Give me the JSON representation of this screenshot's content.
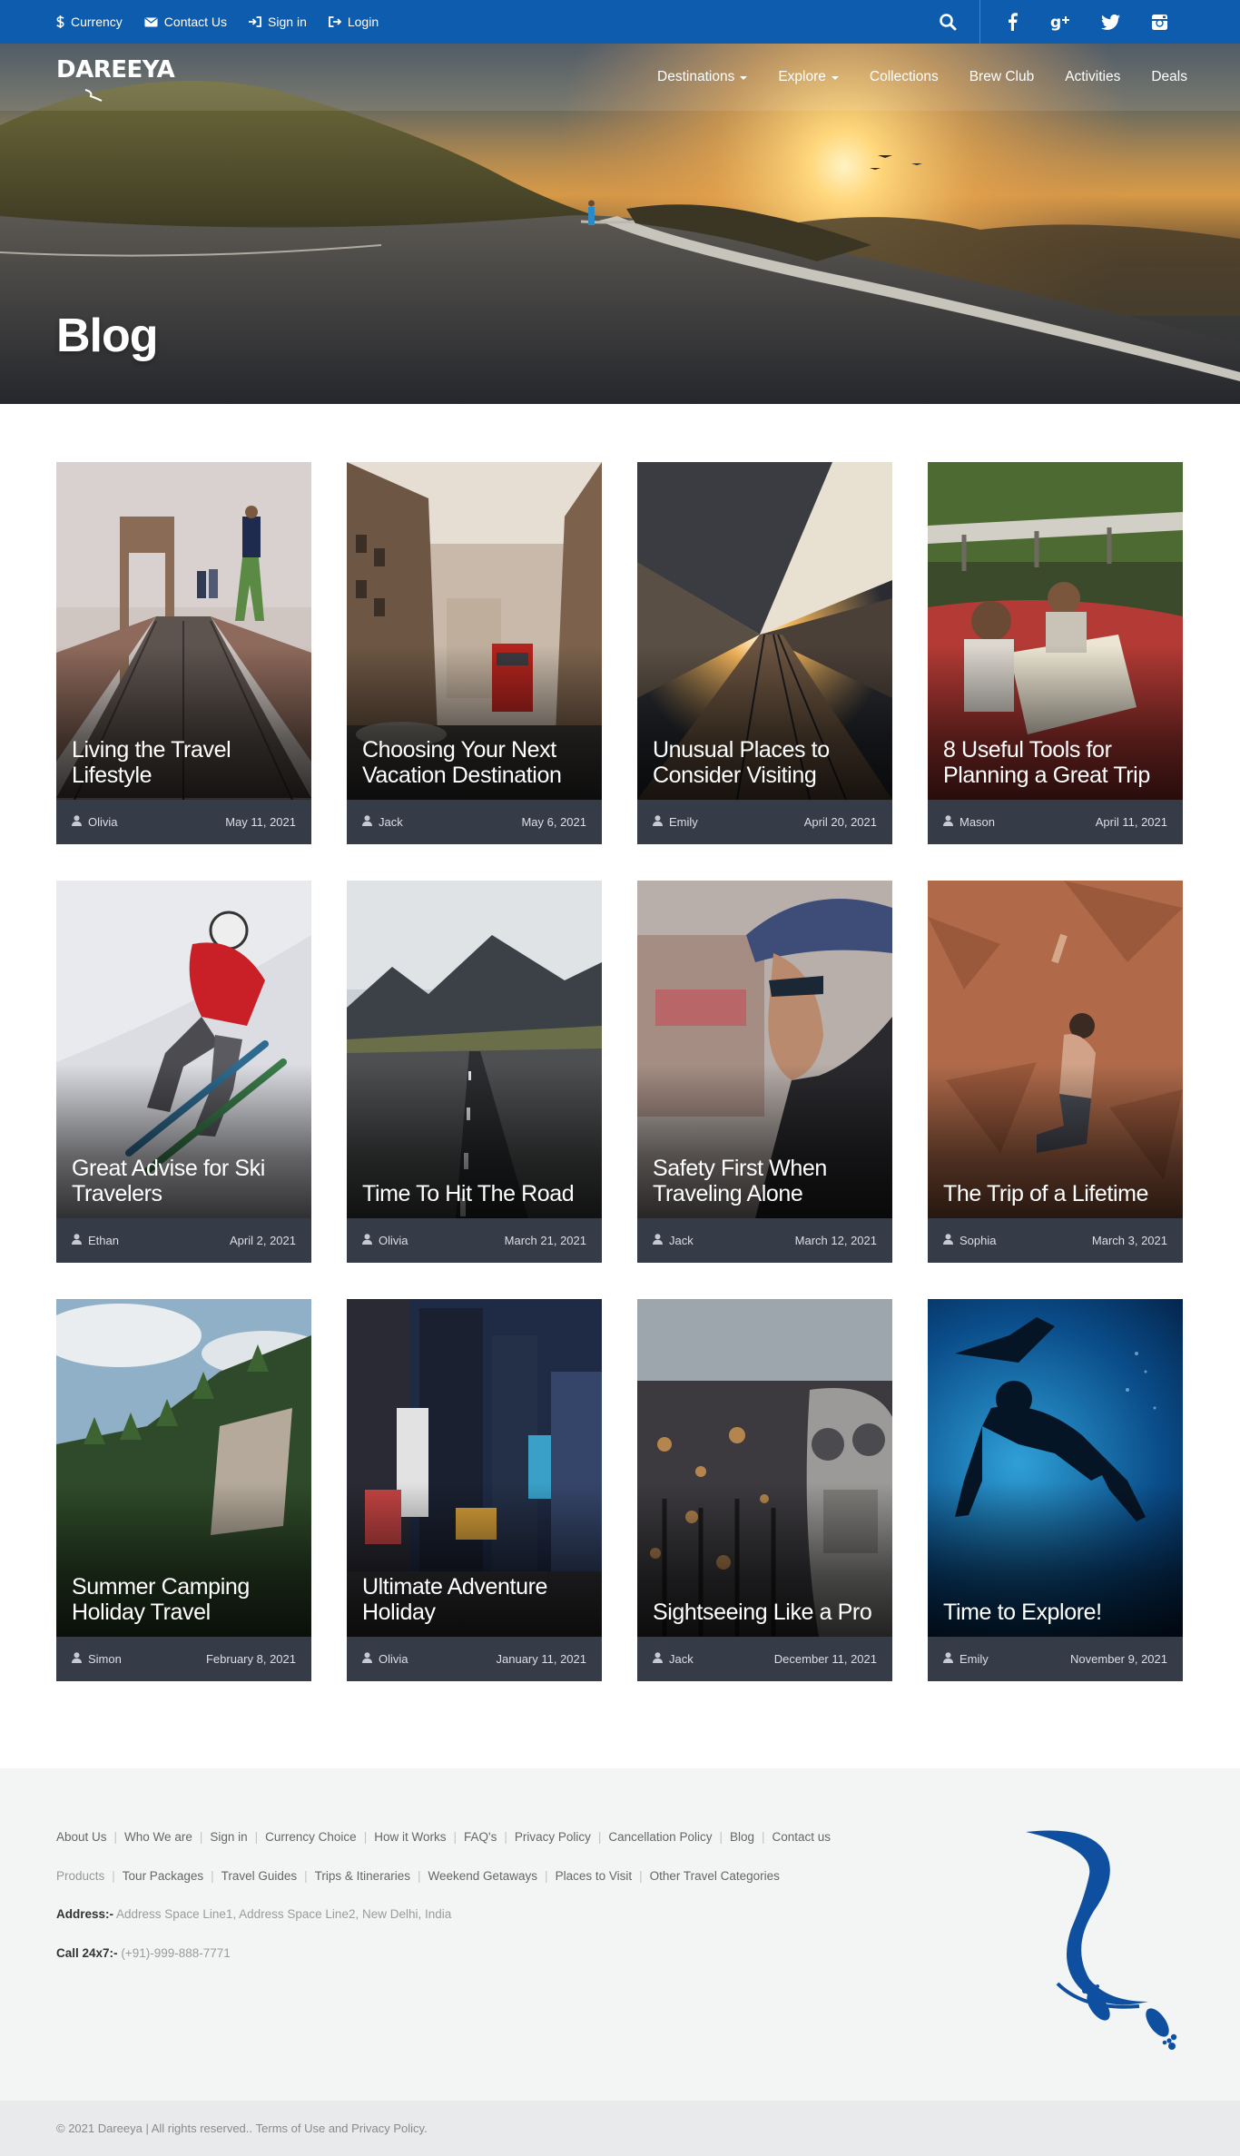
{
  "topbar": {
    "links": [
      {
        "label": "Currency",
        "icon": "dollar-icon"
      },
      {
        "label": "Contact Us",
        "icon": "envelope-icon"
      },
      {
        "label": "Sign in",
        "icon": "sign-in-icon"
      },
      {
        "label": "Login",
        "icon": "log-in-icon"
      }
    ],
    "social": [
      "search-icon",
      "facebook-icon",
      "google-plus-icon",
      "twitter-icon",
      "instagram-icon"
    ]
  },
  "brand": {
    "name": "DAREEYA",
    "primary_color": "#0e5cae",
    "meta_bar_color": "#353b47"
  },
  "nav": {
    "items": [
      {
        "label": "Destinations",
        "dropdown": true
      },
      {
        "label": "Explore",
        "dropdown": true
      },
      {
        "label": "Collections",
        "dropdown": false
      },
      {
        "label": "Brew Club",
        "dropdown": false
      },
      {
        "label": "Activities",
        "dropdown": false
      },
      {
        "label": "Deals",
        "dropdown": false
      }
    ]
  },
  "hero": {
    "title": "Blog"
  },
  "posts": [
    {
      "title": "Living the Travel Lifestyle",
      "author": "Olivia",
      "date": "May 11, 2021"
    },
    {
      "title": "Choosing Your Next Vacation Destination",
      "author": "Jack",
      "date": "May 6, 2021"
    },
    {
      "title": "Unusual Places to Consider Visiting",
      "author": "Emily",
      "date": "April 20, 2021"
    },
    {
      "title": "8 Useful Tools for Planning a Great Trip",
      "author": "Mason",
      "date": "April 11, 2021"
    },
    {
      "title": "Great Advise for Ski Travelers",
      "author": "Ethan",
      "date": "April 2, 2021"
    },
    {
      "title": "Time To Hit The Road",
      "author": "Olivia",
      "date": "March 21, 2021"
    },
    {
      "title": "Safety First When Traveling Alone",
      "author": "Jack",
      "date": "March 12, 2021"
    },
    {
      "title": "The Trip of a Lifetime",
      "author": "Sophia",
      "date": "March 3, 2021"
    },
    {
      "title": "Summer Camping Holiday Travel",
      "author": "Simon",
      "date": "February 8, 2021"
    },
    {
      "title": "Ultimate Adventure Holiday",
      "author": "Olivia",
      "date": "January 11, 2021"
    },
    {
      "title": "Sightseeing Like a Pro",
      "author": "Jack",
      "date": "December 11, 2021"
    },
    {
      "title": "Time to Explore!",
      "author": "Emily",
      "date": "November 9, 2021"
    }
  ],
  "footer": {
    "links_row1": [
      "About Us",
      "Who We are",
      "Sign in",
      "Currency Choice",
      "How it Works",
      "FAQ's",
      "Privacy Policy",
      "Cancellation Policy",
      "Blog",
      "Contact us"
    ],
    "links_row2": [
      "Products",
      "Tour Packages",
      "Travel Guides",
      "Trips & Itineraries",
      "Weekend Getaways",
      "Places to Visit",
      "Other Travel Categories"
    ],
    "address_label": "Address:-",
    "address_value": "Address Space Line1, Address Space Line2, New Delhi, India",
    "call_label": "Call 24x7:-",
    "call_value": "(+91)-999-888-7771",
    "copyright": "© 2021 Dareeya | All rights reserved..",
    "terms_link": "Terms of Use and Privacy Policy."
  }
}
